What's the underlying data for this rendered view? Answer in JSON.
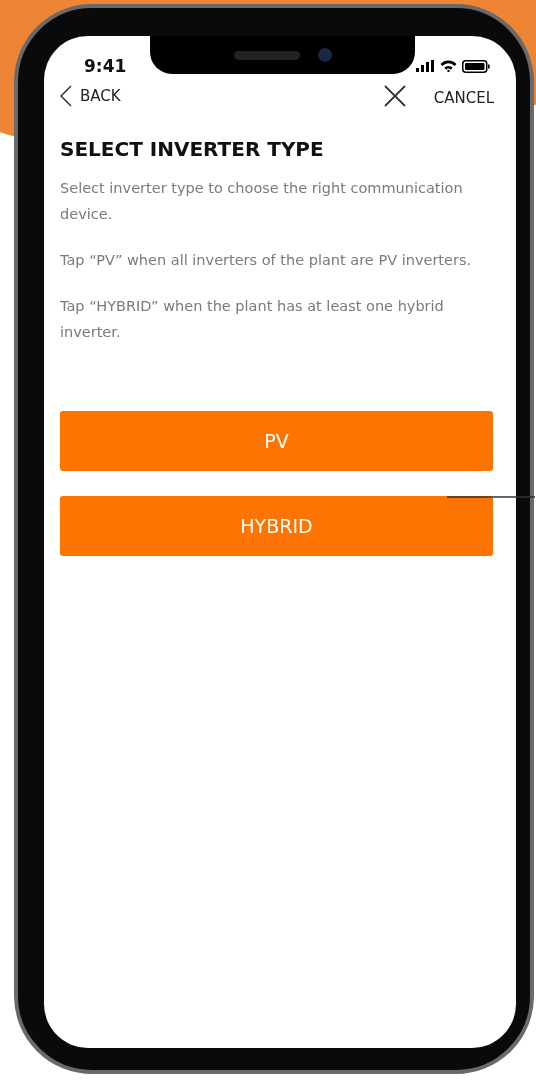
{
  "status_bar": {
    "time": "9:41"
  },
  "nav": {
    "back": "BACK",
    "cancel": "CANCEL"
  },
  "title": "SELECT INVERTER TYPE",
  "paragraphs": [
    "Select inverter type to choose the right communication device.",
    "Tap “PV” when all inverters of the plant are PV inverters.",
    "Tap “HYBRID” when the plant has at least one hybrid inverter."
  ],
  "buttons": [
    "PV",
    "HYBRID"
  ]
}
